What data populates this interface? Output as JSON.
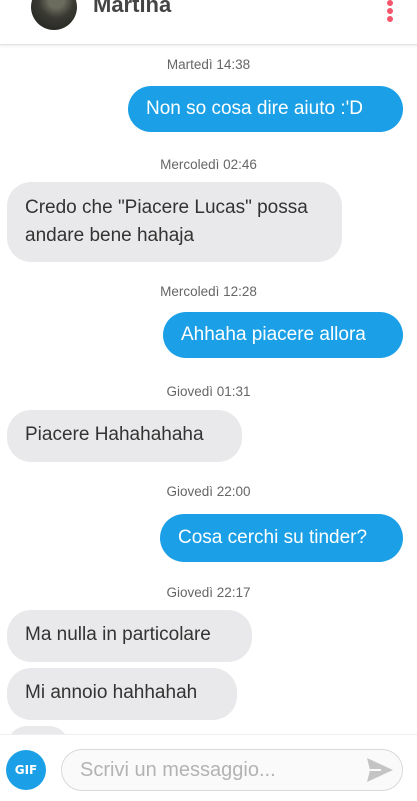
{
  "header": {
    "contact_name": "Martina"
  },
  "messages": [
    {
      "timestamp": "Martedì 14:38",
      "text": "Non so cosa dire aiuto :'D",
      "direction": "outgoing"
    },
    {
      "timestamp": "Mercoledì 02:46",
      "text": "Credo che \"Piacere Lucas\" possa andare bene hahaja",
      "direction": "incoming"
    },
    {
      "timestamp": "Mercoledì 12:28",
      "text": "Ahhaha piacere allora",
      "direction": "outgoing"
    },
    {
      "timestamp": "Giovedì 01:31",
      "text": "Piacere Hahahahaha",
      "direction": "incoming"
    },
    {
      "timestamp": "Giovedì 22:00",
      "text": "Cosa cerchi su tinder?",
      "direction": "outgoing"
    },
    {
      "timestamp": "Giovedì 22:17",
      "text": "Ma nulla in particolare",
      "direction": "incoming"
    },
    {
      "text": "Mi annoio hahhahah",
      "direction": "incoming"
    }
  ],
  "composer": {
    "gif_label": "GIF",
    "placeholder": "Scrivi un messaggio..."
  },
  "colors": {
    "accent": "#1ba0e7",
    "incoming_bubble": "#e9e9eb",
    "menu_dots": "#f2566b"
  },
  "icons": {
    "menu": "kebab-menu-icon",
    "send": "send-icon"
  }
}
